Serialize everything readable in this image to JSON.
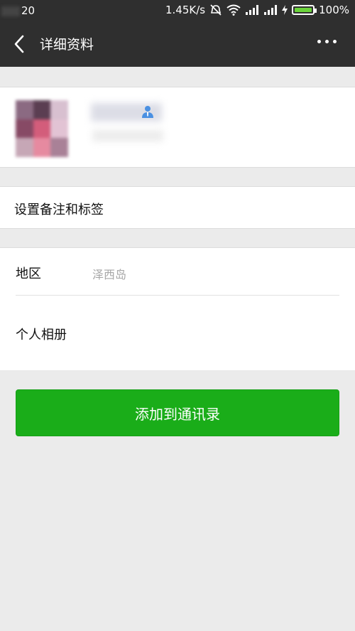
{
  "status_bar": {
    "time": "20",
    "network_speed": "1.45K/s",
    "battery": "100%"
  },
  "nav": {
    "title": "详细资料"
  },
  "profile": {
    "name": "",
    "subtitle": ""
  },
  "remark": {
    "label": "设置备注和标签"
  },
  "info": {
    "region_label": "地区",
    "region_value": "泽西岛",
    "album_label": "个人相册"
  },
  "actions": {
    "add_contact_label": "添加到通讯录"
  },
  "colors": {
    "header_bg": "#2f2f2f",
    "page_bg": "#ebebeb",
    "primary_button": "#1aad19",
    "contact_icon": "#4a90e2"
  }
}
